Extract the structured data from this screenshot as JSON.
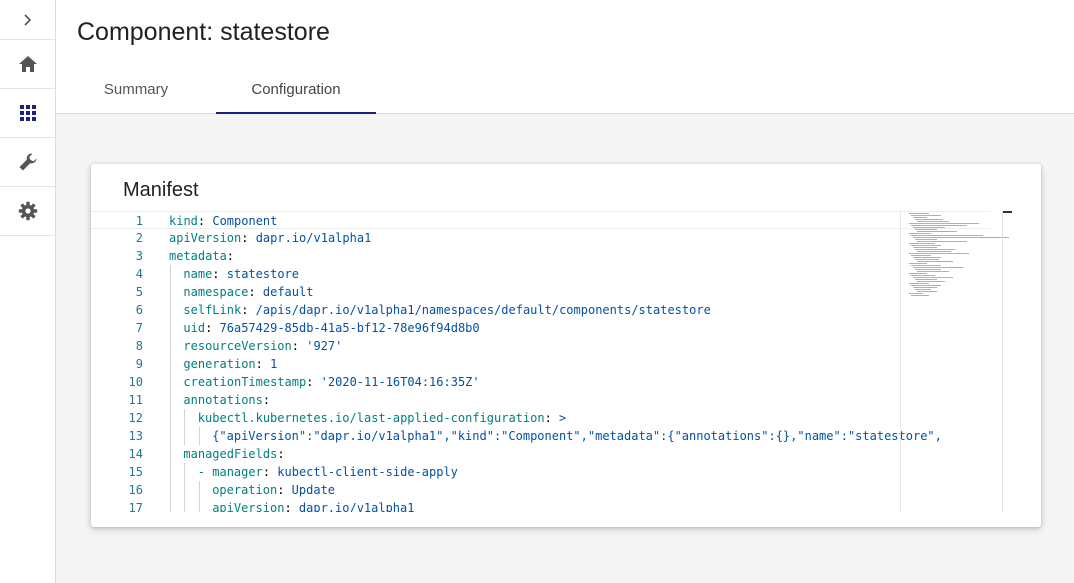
{
  "page": {
    "title": "Component: statestore"
  },
  "tabs": [
    {
      "label": "Summary",
      "active": false
    },
    {
      "label": "Configuration",
      "active": true
    }
  ],
  "sidebar": {
    "items": [
      {
        "icon": "chevron-right-icon"
      },
      {
        "icon": "home-icon"
      },
      {
        "icon": "apps-grid-icon"
      },
      {
        "icon": "wrench-icon"
      },
      {
        "icon": "gear-icon"
      }
    ],
    "active_color": "#1a237e"
  },
  "manifest": {
    "title": "Manifest",
    "lines": [
      {
        "n": "1",
        "indent": 0,
        "key": "kind",
        "sep": ": ",
        "value": "Component"
      },
      {
        "n": "2",
        "indent": 0,
        "key": "apiVersion",
        "sep": ": ",
        "value": "dapr.io/v1alpha1"
      },
      {
        "n": "3",
        "indent": 0,
        "key": "metadata",
        "sep": ":",
        "value": ""
      },
      {
        "n": "4",
        "indent": 1,
        "key": "name",
        "sep": ": ",
        "value": "statestore"
      },
      {
        "n": "5",
        "indent": 1,
        "key": "namespace",
        "sep": ": ",
        "value": "default"
      },
      {
        "n": "6",
        "indent": 1,
        "key": "selfLink",
        "sep": ": ",
        "value": "/apis/dapr.io/v1alpha1/namespaces/default/components/statestore"
      },
      {
        "n": "7",
        "indent": 1,
        "key": "uid",
        "sep": ": ",
        "value": "76a57429-85db-41a5-bf12-78e96f94d8b0"
      },
      {
        "n": "8",
        "indent": 1,
        "key": "resourceVersion",
        "sep": ": ",
        "value": "'927'"
      },
      {
        "n": "9",
        "indent": 1,
        "key": "generation",
        "sep": ": ",
        "value": "1"
      },
      {
        "n": "10",
        "indent": 1,
        "key": "creationTimestamp",
        "sep": ": ",
        "value": "'2020-11-16T04:16:35Z'"
      },
      {
        "n": "11",
        "indent": 1,
        "key": "annotations",
        "sep": ":",
        "value": ""
      },
      {
        "n": "12",
        "indent": 2,
        "key": "kubectl.kubernetes.io/last-applied-configuration",
        "sep": ": ",
        "value": ">"
      },
      {
        "n": "13",
        "indent": 3,
        "key": "",
        "sep": "",
        "value": "{\"apiVersion\":\"dapr.io/v1alpha1\",\"kind\":\"Component\",\"metadata\":{\"annotations\":{},\"name\":\"statestore\",\"namespace\":\"default\"}"
      },
      {
        "n": "14",
        "indent": 1,
        "key": "managedFields",
        "sep": ":",
        "value": ""
      },
      {
        "n": "15",
        "indent": 2,
        "key": "- manager",
        "sep": ": ",
        "value": "kubectl-client-side-apply"
      },
      {
        "n": "16",
        "indent": 3,
        "key": "operation",
        "sep": ": ",
        "value": "Update"
      },
      {
        "n": "17",
        "indent": 3,
        "key": "apiVersion",
        "sep": ": ",
        "value": "dapr.io/v1alpha1"
      }
    ]
  },
  "colors": {
    "line_number": "#237893",
    "yaml_key": "#008080",
    "yaml_value": "#0451a5",
    "tab_indicator": "#1a237e"
  }
}
